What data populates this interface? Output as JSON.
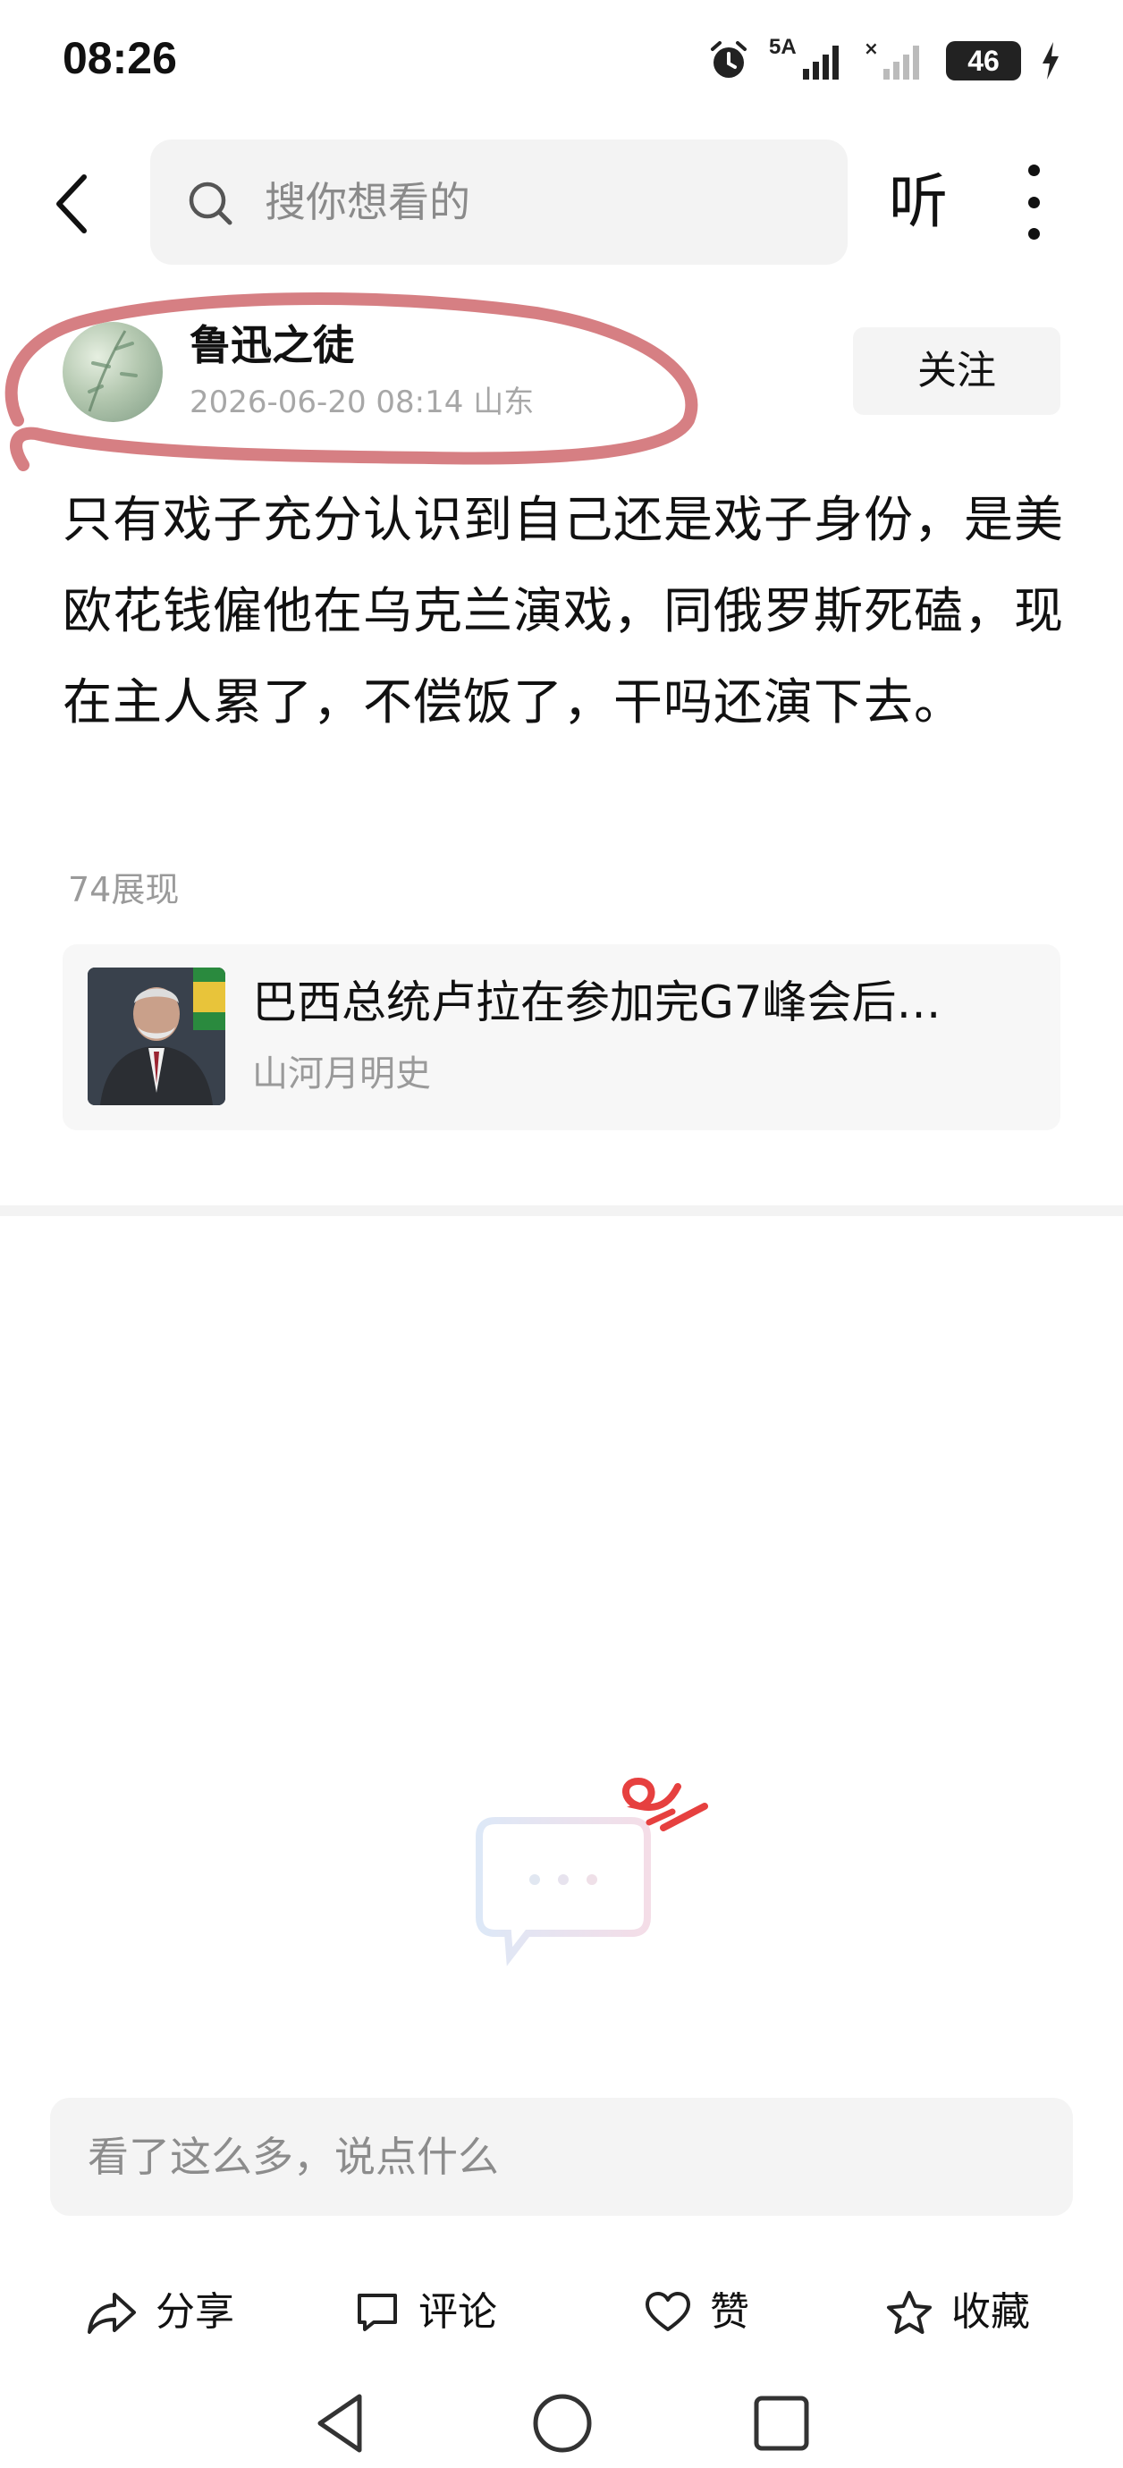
{
  "status_bar": {
    "time": "08:26",
    "network_label": "5A",
    "battery_level": "46",
    "icons": [
      "alarm-icon",
      "signal-icon",
      "signal-icon",
      "battery-icon",
      "charging-icon"
    ]
  },
  "top_nav": {
    "search_placeholder": "搜你想看的",
    "listen_label": "听"
  },
  "author": {
    "name": "鲁迅之徒",
    "meta": "2026-06-20 08:14 山东",
    "follow_label": "关注"
  },
  "post": {
    "text": "只有戏子充分认识到自己还是戏子身份，是美欧花钱僱他在乌克兰演戏，同俄罗斯死磕，现在主人累了，不偿饭了，干吗还演下去。",
    "views": "74展现"
  },
  "linked_article": {
    "title": "巴西总统卢拉在参加完G7峰会后…",
    "source": "山河月明史"
  },
  "comment_box": {
    "placeholder": "看了这么多，说点什么"
  },
  "actions": [
    {
      "icon": "share-icon",
      "label": "分享"
    },
    {
      "icon": "comment-icon",
      "label": "评论"
    },
    {
      "icon": "heart-icon",
      "label": "赞"
    },
    {
      "icon": "star-icon",
      "label": "收藏"
    }
  ],
  "colors": {
    "highlight_annotation": "#c8545a",
    "accent_red": "#e6403f",
    "muted_text": "#a7a7a7",
    "surface": "#f4f4f4"
  }
}
